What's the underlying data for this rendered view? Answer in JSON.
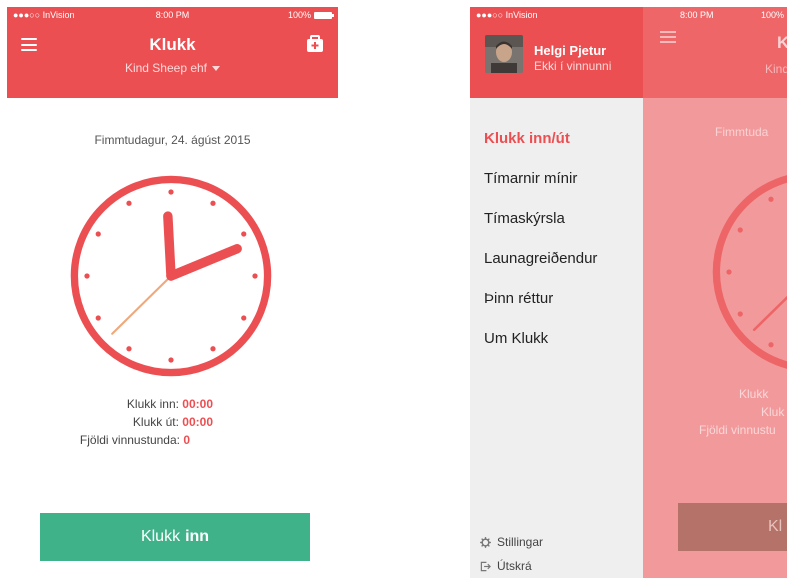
{
  "status_bar": {
    "carrier": "●●●○○ InVision",
    "time": "8:00 PM",
    "battery": "100%"
  },
  "left_screen": {
    "title": "Klukk",
    "company": "Kind Sheep ehf",
    "date": "Fimmtudagur, 24. ágúst 2015",
    "stats": {
      "clock_in_label": "Klukk inn:",
      "clock_in_value": "00:00",
      "clock_out_label": "Klukk út:",
      "clock_out_value": "00:00",
      "sessions_label": "Fjöldi vinnustunda:",
      "sessions_value": "0"
    },
    "button": {
      "prefix": "Klukk",
      "emphasis": "inn"
    }
  },
  "right_screen": {
    "user": {
      "name": "Helgi Pjetur",
      "status": "Ekki í vinnunni"
    },
    "menu_items": [
      {
        "label": "Klukk inn/út",
        "active": true
      },
      {
        "label": "Tímarnir mínir",
        "active": false
      },
      {
        "label": "Tímaskýrsla",
        "active": false
      },
      {
        "label": "Launagreiðendur",
        "active": false
      },
      {
        "label": "Þinn réttur",
        "active": false
      },
      {
        "label": "Um Klukk",
        "active": false
      }
    ],
    "footer": {
      "settings": "Stillingar",
      "logout": "Útskrá"
    },
    "background_peek": {
      "title": "K",
      "company": "Kind",
      "date": "Fimmtuda",
      "stat1": "Klukk",
      "stat2": "Kluk",
      "stat3": "Fjöldi vinnustu",
      "button": "Kl"
    }
  },
  "colors": {
    "brand_red": "#ec4f52",
    "button_green": "#3fb28a",
    "drawer_bg": "#efefef",
    "overlay_pink": "#f29a9b"
  },
  "icons": {
    "menu": "hamburger-icon",
    "kit": "first-aid-kit-icon",
    "settings": "gear-icon",
    "logout": "logout-icon",
    "dropdown": "caret-down-icon"
  }
}
